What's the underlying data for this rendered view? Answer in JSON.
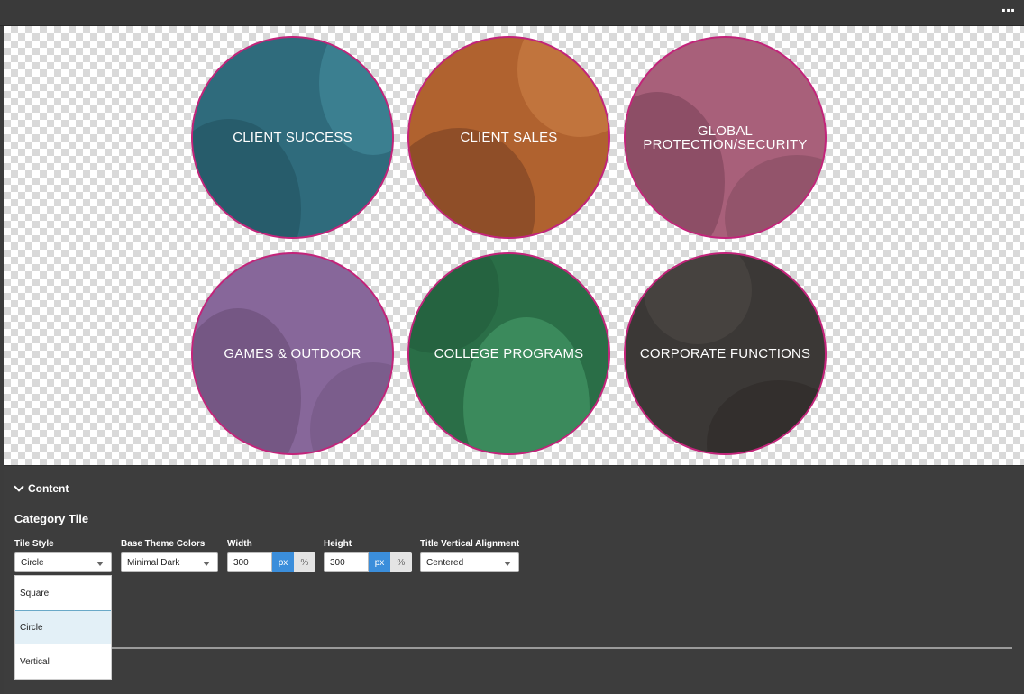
{
  "toolbar": {
    "more_icon": "more-horizontal-icon"
  },
  "tiles": [
    {
      "title": "CLIENT SUCCESS",
      "color": "#2f6b7c"
    },
    {
      "title": "CLIENT SALES",
      "color": "#b0622f"
    },
    {
      "title": "GLOBAL\nPROTECTION/SECURITY",
      "color": "#a8607a"
    },
    {
      "title": "GAMES & OUTDOOR",
      "color": "#87679a"
    },
    {
      "title": "COLLEGE PROGRAMS",
      "color": "#2a6e47"
    },
    {
      "title": "CORPORATE FUNCTIONS",
      "color": "#3b3836"
    }
  ],
  "tile_border_color": "#c2247a",
  "panel": {
    "section_label": "Content",
    "group_title": "Category Tile",
    "tile_style": {
      "label": "Tile Style",
      "value": "Circle"
    },
    "base_theme": {
      "label": "Base Theme Colors",
      "value": "Minimal Dark"
    },
    "width": {
      "label": "Width",
      "value": "300",
      "unit_px": "px",
      "unit_pct": "%"
    },
    "height": {
      "label": "Height",
      "value": "300",
      "unit_px": "px",
      "unit_pct": "%"
    },
    "title_alignment": {
      "label": "Title Vertical Alignment",
      "value": "Centered"
    },
    "tile_style_options": [
      "Square",
      "Circle",
      "Vertical"
    ],
    "selected_option": "Circle"
  }
}
